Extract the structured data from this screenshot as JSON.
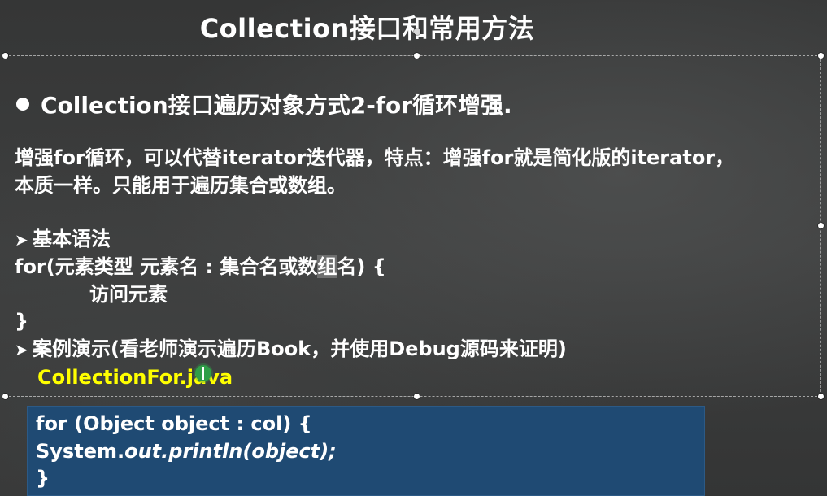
{
  "slide": {
    "title": "Collection接口和常用方法",
    "bullet": "Collection接口遍历对象方式2-for循环增强.",
    "description": {
      "line1": "增强for循环，可以代替iterator迭代器，特点：增强for就是简化版的iterator，",
      "line2": "本质一样。只能用于遍历集合或数组。"
    },
    "syntax": {
      "heading": "基本语法",
      "line1_pre": "for(元素类型 元素名 : 集合名或数",
      "line1_hl": "组",
      "line1_post": "名) {",
      "line2": "访问元素",
      "line3": "}"
    },
    "demo": {
      "heading": "案例演示(看老师演示遍历Book，并使用Debug源码来证明)",
      "file": "CollectionFor.java"
    },
    "code": {
      "line1": "for (Object object : col) {",
      "line2_plain": "System.",
      "line2_italic": "out.println(object);",
      "line3": "}"
    }
  },
  "icons": {
    "bullet": "filled-circle-bullet",
    "arrow": "arrow-head-bullet",
    "cursor": "mouse-cursor-indicator"
  },
  "colors": {
    "background": "#3a3b3b",
    "text": "#ffffff",
    "highlight_text": "#ffff00",
    "code_background": "#1f4a73"
  }
}
